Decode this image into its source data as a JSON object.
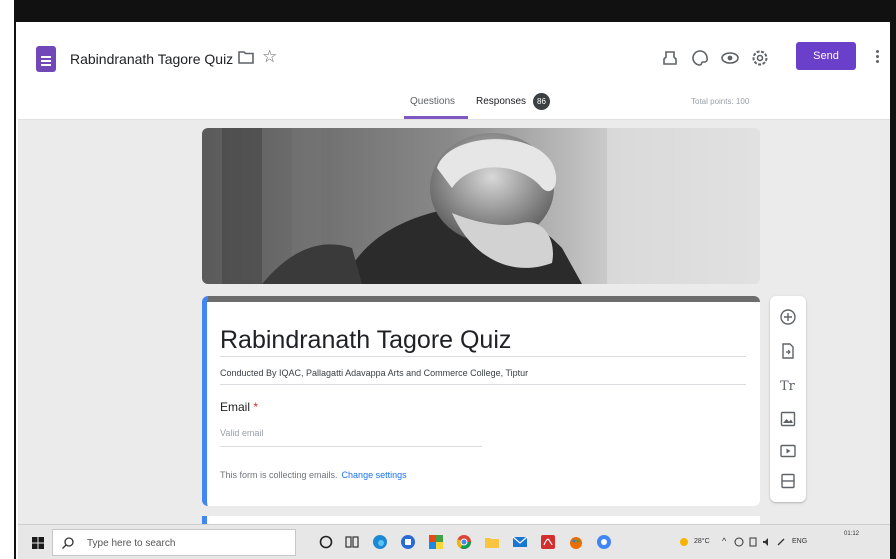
{
  "app": {
    "title": "Rabindranath Tagore Quiz",
    "send_label": "Send",
    "accent_color": "#6a3fc9",
    "icons": [
      "folder-icon",
      "star-icon",
      "customize-icon",
      "palette-icon",
      "preview-icon",
      "settings-icon",
      "more-icon"
    ]
  },
  "tabs": [
    {
      "label": "Questions",
      "active": true
    },
    {
      "label": "Responses",
      "badge": "86"
    }
  ],
  "total_points": "Total points: 100",
  "form": {
    "title": "Rabindranath Tagore Quiz",
    "description": "Conducted By IQAC, Pallagatti Adavappa Arts and Commerce College, Tiptur",
    "email_label": "Email",
    "required_marker": "*",
    "email_placeholder": "Valid email",
    "collecting_text": "This form is collecting emails.",
    "change_settings": "Change settings"
  },
  "side_toolbar": [
    "add-question-icon",
    "import-questions-icon",
    "add-title-icon",
    "add-image-icon",
    "add-video-icon",
    "add-section-icon"
  ],
  "taskbar": {
    "search_placeholder": "Type here to search",
    "temperature": "28°C",
    "language": "ENG",
    "time": "01:12"
  }
}
